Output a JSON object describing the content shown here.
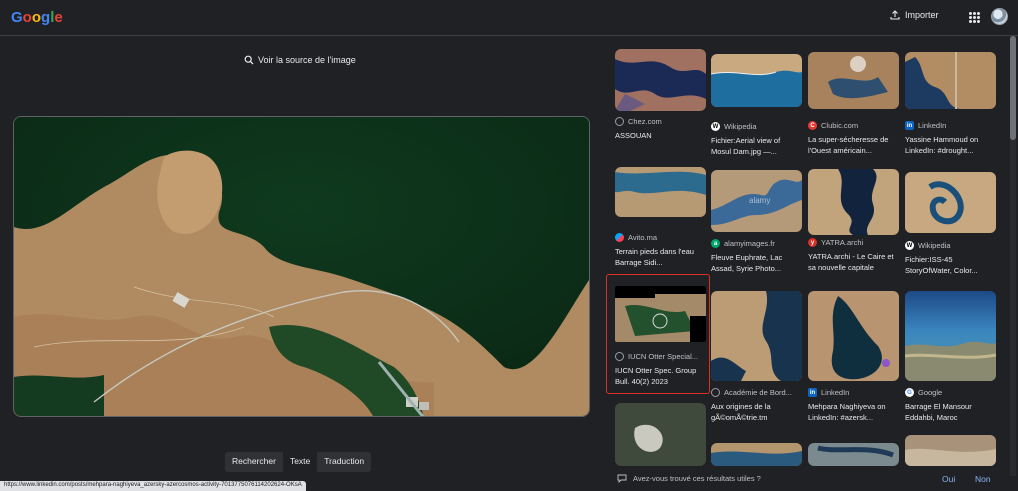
{
  "header": {
    "logo_text": "Google",
    "import_label": "Importer",
    "apps_icon": "apps-grid-icon",
    "avatar_icon": "account-avatar"
  },
  "left": {
    "source_link": "Voir la source de l'image",
    "tabs": [
      {
        "label": "Rechercher",
        "active": false
      },
      {
        "label": "Texte",
        "active": true
      },
      {
        "label": "Traduction",
        "active": false
      }
    ]
  },
  "status_url": "https://www.linkedin.com/posts/mehpara-naghiyeva_azersky-azercosmos-activity-7013775076114202624-OKsA",
  "results": [
    {
      "source": "Chez.com",
      "title": "ASSOUAN",
      "fav_color": "#5f6368",
      "fav_letter": ""
    },
    {
      "source": "Wikipedia",
      "title": "Fichier:Aerial view of Mosul Dam.jpg —...",
      "fav_color": "#ffffff",
      "fav_letter": "W"
    },
    {
      "source": "Clubic.com",
      "title": "La super-sécheresse de l'Ouest américain...",
      "fav_color": "#e53935",
      "fav_letter": "C"
    },
    {
      "source": "LinkedIn",
      "title": "Yassine Hammoud on LinkedIn: #drought...",
      "fav_color": "#0a66c2",
      "fav_letter": "in"
    },
    {
      "source": "Avito.ma",
      "title": "Terrain pieds dans l'eau Barrage Sidi...",
      "fav_color": "#7b61ff",
      "fav_letter": ""
    },
    {
      "source": "alamyimages.fr",
      "title": "Fleuve Euphrate, Lac Assad, Syrie Photo...",
      "fav_color": "#00a86b",
      "fav_letter": "a"
    },
    {
      "source": "YATRA.archi",
      "title": "YATRA.archi - Le Caire et sa nouvelle capitale",
      "fav_color": "#d93025",
      "fav_letter": "y"
    },
    {
      "source": "Wikipedia",
      "title": "Fichier:ISS-45 StoryOfWater, Color...",
      "fav_color": "#ffffff",
      "fav_letter": "W"
    },
    {
      "source": "IUCN Otter Special...",
      "title": "IUCN Otter Spec. Group Bull. 40(2) 2023",
      "fav_color": "#5f6368",
      "fav_letter": ""
    },
    {
      "source": "Académie de Bord...",
      "title": "Aux origines de la gÃ©omÃ©trie.tm",
      "fav_color": "#5f6368",
      "fav_letter": ""
    },
    {
      "source": "LinkedIn",
      "title": "Mehpara Naghiyeva on LinkedIn: #azersk...",
      "fav_color": "#0a66c2",
      "fav_letter": "in"
    },
    {
      "source": "Google",
      "title": "Barrage El Mansour Eddahbi, Maroc",
      "fav_color": "#ffffff",
      "fav_letter": "G"
    }
  ],
  "watermark": "alamy",
  "feedback": {
    "question": "Avez-vous trouvé ces résultats utiles ?",
    "yes": "Oui",
    "no": "Non"
  }
}
